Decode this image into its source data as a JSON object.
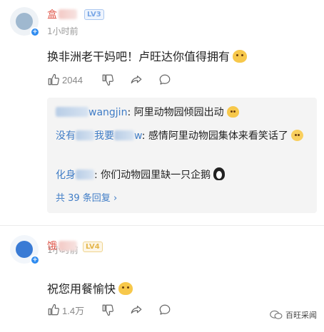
{
  "comments": [
    {
      "username": "盒",
      "level": "LV3",
      "time": "1小时前",
      "text": "换非洲老干妈吧！卢旺达你值得拥有",
      "likes": "2044",
      "replies": [
        {
          "name_tail": "wangjin",
          "text": ": 阿里动物园倾园出动"
        },
        {
          "name_prefix": "没有",
          "name_mid": "我要",
          "name_tail": "w",
          "text": ": 感情阿里动物园集体来看笑话了"
        },
        {
          "name_prefix": "化身",
          "text": ": 你们动物园里缺一只企鹅"
        }
      ],
      "more_replies": "共 39 条回复 ›"
    },
    {
      "username": "饿",
      "level": "LV4",
      "time": "1小时前",
      "text": "祝您用餐愉快",
      "likes": "1.4万"
    }
  ],
  "watermark": "百旺采闻",
  "colors": {
    "username": "#e0584b",
    "reply_name": "#3f7cc6",
    "level3": "#7aa7e6",
    "level4": "#e4b64a"
  },
  "icons": [
    "thumbs-up-icon",
    "thumbs-down-icon",
    "share-icon",
    "reply-bubble-icon"
  ]
}
